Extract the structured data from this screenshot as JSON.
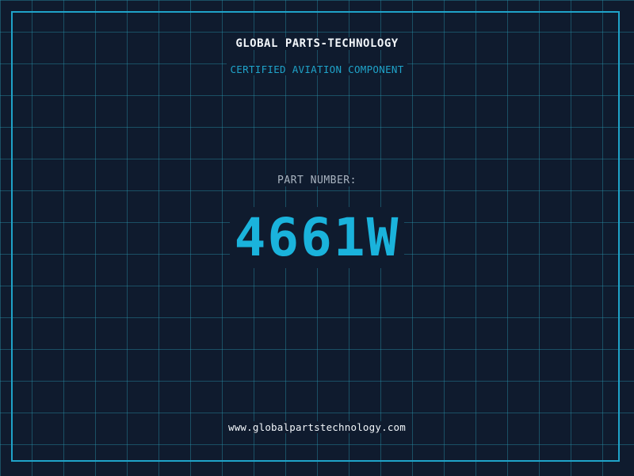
{
  "header": {
    "company": "GLOBAL PARTS-TECHNOLOGY",
    "subtitle": "CERTIFIED AVIATION COMPONENT"
  },
  "part": {
    "label": "PART NUMBER:",
    "number": "4661W"
  },
  "footer": {
    "website": "www.globalpartstechnology.com"
  },
  "colors": {
    "background": "#0f1b2e",
    "accent": "#1fa3c9",
    "grid": "#2896af",
    "text": "#f2f6fa"
  }
}
